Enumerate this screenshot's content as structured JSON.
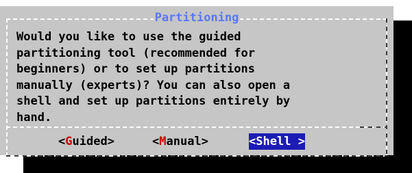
{
  "dialog": {
    "title": "Partitioning",
    "message": "Would you like to use the guided\npartitioning tool (recommended for\nbeginners) or to set up partitions\nmanually (experts)? You can also open a\nshell and set up partitions entirely by\nhand."
  },
  "buttons": [
    {
      "open": "<",
      "hotkey": "G",
      "rest": "uided",
      "close": ">",
      "selected": false
    },
    {
      "open": "<",
      "hotkey": "M",
      "rest": "anual",
      "close": ">",
      "selected": false
    },
    {
      "open": "<",
      "hotkey": "S",
      "rest": "hell ",
      "close": ">",
      "selected": true
    }
  ],
  "colors": {
    "dialog_bg": "#c6c6c6",
    "title": "#5a78ff",
    "hotkey": "#cc0000",
    "selected_bg": "#1c1cb4"
  }
}
